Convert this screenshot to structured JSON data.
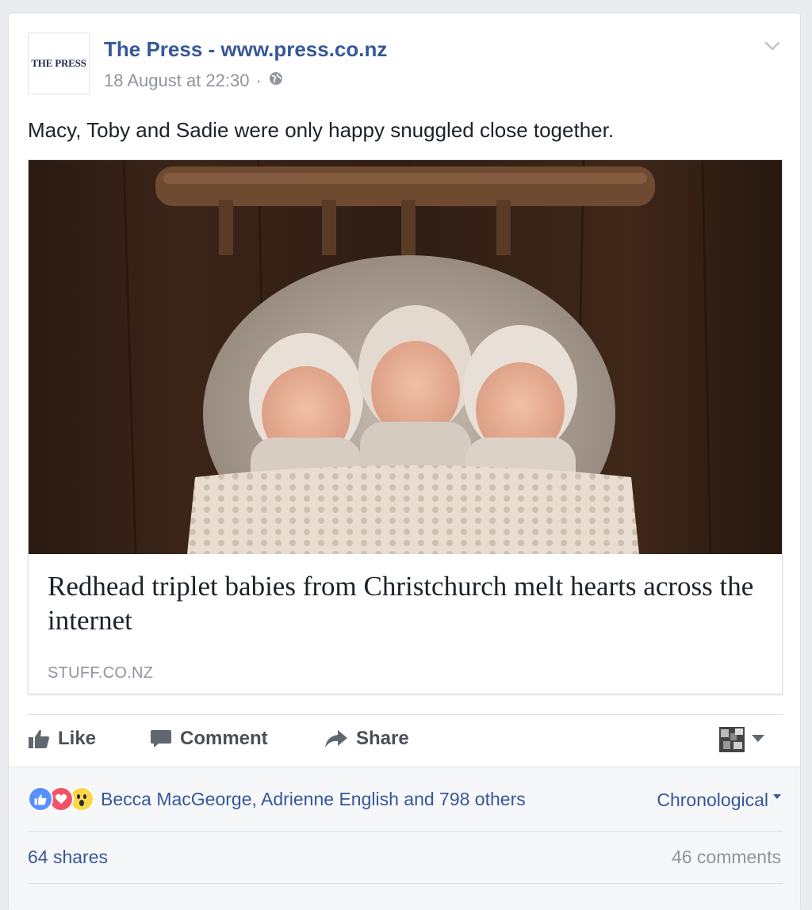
{
  "post": {
    "page_name": "The Press - www.press.co.nz",
    "logo_text": "THE PRESS",
    "timestamp": "18 August at 22:30",
    "separator": "·",
    "audience_icon": "globe-icon",
    "text": "Macy, Toby and Sadie were only happy snuggled close together."
  },
  "link_preview": {
    "image_description": "three newborn triplets in bonnets asleep on a wooden bed",
    "headline": "Redhead triplet babies from Christchurch melt hearts across the internet",
    "domain": "STUFF.CO.NZ"
  },
  "actions": {
    "like_label": "Like",
    "comment_label": "Comment",
    "share_label": "Share"
  },
  "footer": {
    "reaction_icons": [
      "like-icon",
      "love-icon",
      "wow-icon"
    ],
    "reaction_summary": "Becca MacGeorge, Adrienne English and 798 others",
    "sort_label": "Chronological",
    "shares_label": "64 shares",
    "comments_label": "46 comments"
  },
  "colors": {
    "link_blue": "#365899",
    "secondary_grey": "#90949c",
    "like_blue": "#5890ff",
    "love_red": "#f25268",
    "wow_yellow": "#fcd548"
  }
}
